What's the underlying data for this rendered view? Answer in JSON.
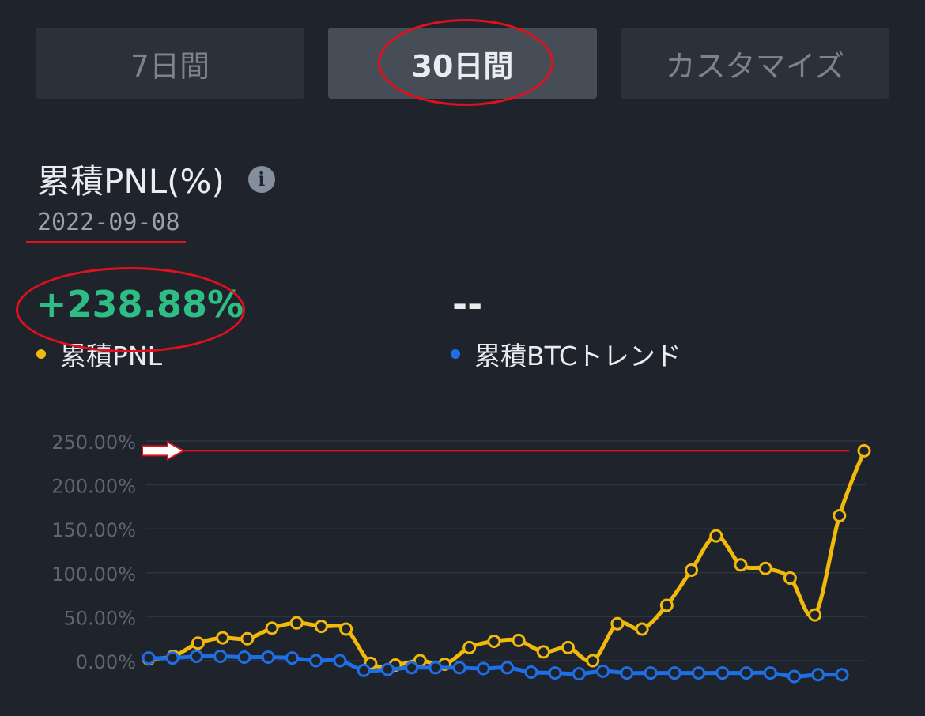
{
  "tabs": [
    {
      "label": "7日間",
      "active": false
    },
    {
      "label": "30日間",
      "active": true
    },
    {
      "label": "カスタマイズ",
      "active": false
    }
  ],
  "title": "累積PNL(%)",
  "info_icon": "info-icon",
  "date": "2022-09-08",
  "pnl_value": "+238.88%",
  "btc_value": "--",
  "legend": {
    "pnl": {
      "label": "累積PNL",
      "color": "#f0b90b"
    },
    "btc": {
      "label": "累積BTCトレンド",
      "color": "#1e6fe6"
    }
  },
  "colors": {
    "positive": "#2ebd85",
    "annotation": "#e0101c",
    "pnl_line": "#f0b90b",
    "btc_line": "#1e6fe6"
  },
  "chart_data": {
    "type": "line",
    "ylim": [
      -20,
      250
    ],
    "yticks": [
      0,
      50,
      100,
      150,
      200,
      250
    ],
    "ytick_labels": [
      "0.00%",
      "50.00%",
      "100.00%",
      "150.00%",
      "200.00%",
      "250.00%"
    ],
    "grid": true,
    "series": [
      {
        "name": "累積PNL",
        "values": [
          2,
          5,
          20,
          26,
          25,
          37,
          43,
          39,
          36,
          -3,
          -5,
          0,
          -4,
          15,
          22,
          23,
          10,
          15,
          0,
          42,
          36,
          63,
          103,
          142,
          109,
          105,
          94,
          52,
          165,
          238.88
        ]
      },
      {
        "name": "累積BTCトレンド",
        "values": [
          3,
          3,
          5,
          5,
          4,
          4,
          3,
          0,
          0,
          -11,
          -10,
          -8,
          -8,
          -8,
          -9,
          -8,
          -13,
          -14,
          -15,
          -12,
          -14,
          -14,
          -14,
          -14,
          -14,
          -14,
          -14,
          -18,
          -16,
          -16
        ]
      }
    ],
    "reference_line": 238.88
  }
}
